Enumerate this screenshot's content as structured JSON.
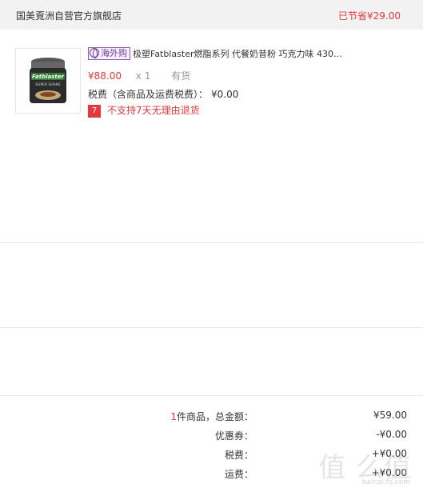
{
  "store": {
    "name": "国美覔洲自营官方旗舰店",
    "saving": "已节省¥29.00"
  },
  "product": {
    "badge_label": "海外购",
    "title": "极塑Fatblaster燃脂系列 代餐奶昔粉 巧克力味 430…",
    "price": "¥88.00",
    "quantity": "x 1",
    "stock": "有货",
    "tax_label": "税费（含商品及运费税费）：",
    "tax_value": "¥0.00",
    "no_return_icon": "7",
    "no_return_text": "不支持7天无理由退货",
    "image_brand": "Fatblaster",
    "image_caption": "SUPER SHAKE"
  },
  "summary": {
    "items_count": "1",
    "items_label": "件商品，总金额：",
    "total_value": "¥59.00",
    "discount_label": "优惠券：",
    "discount_value": "-¥0.00",
    "tax_label": "税费：",
    "tax_value": "+¥0.00",
    "shipping_label": "运费：",
    "shipping_value": "+¥0.00"
  },
  "watermark": {
    "text": "值 么值",
    "sub": "baicai.fo.com"
  },
  "colors": {
    "accent": "#e4393c",
    "badge": "#6c3d9a",
    "header_bg": "#f2f2f2"
  }
}
